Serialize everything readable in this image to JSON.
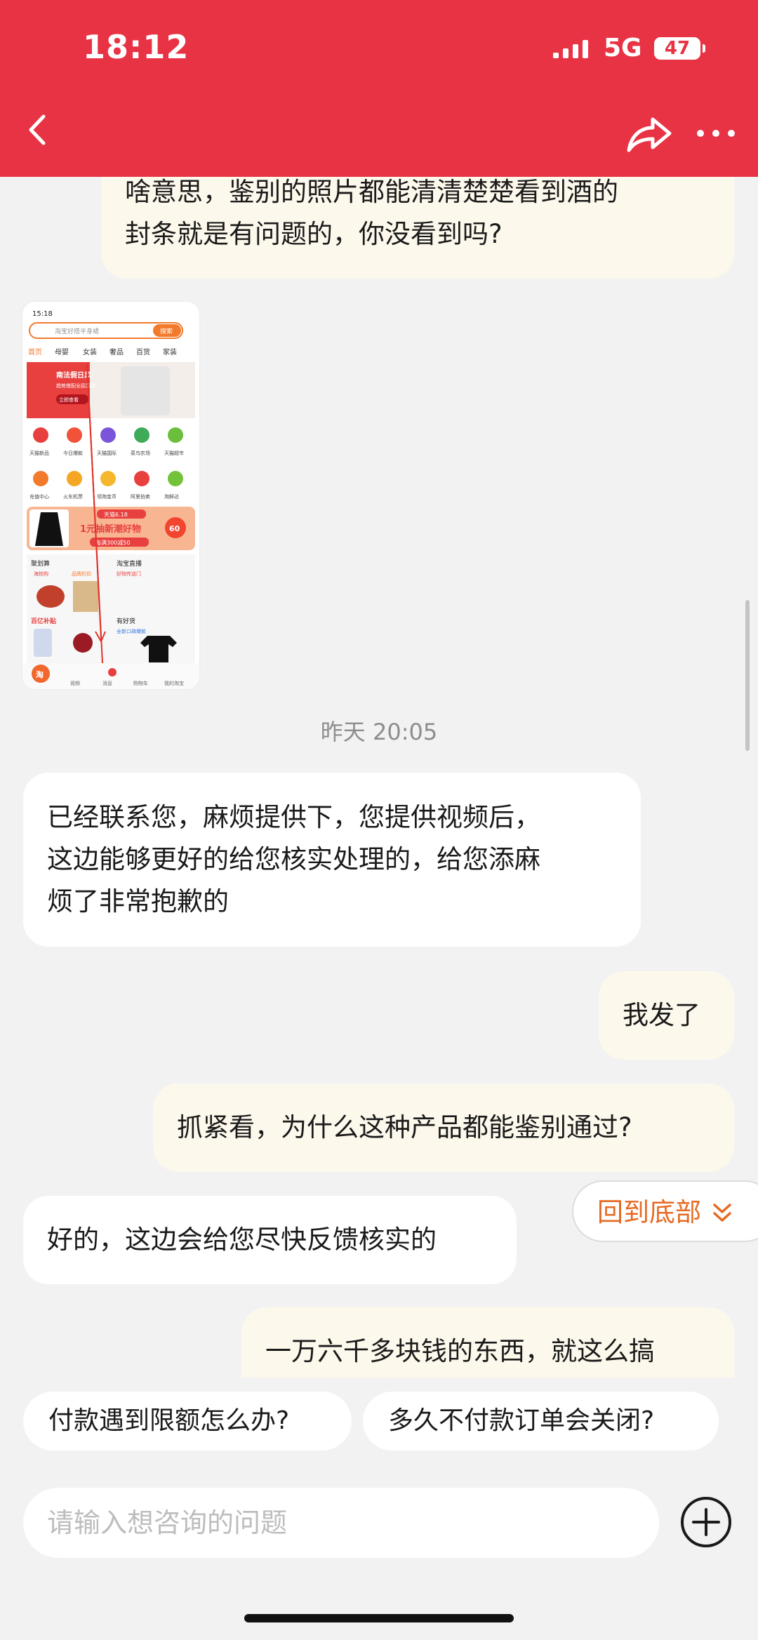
{
  "status_bar": {
    "time": "18:12",
    "network": "5G",
    "battery": "47"
  },
  "messages": {
    "m1": {
      "line1": "啥意思，鉴别的照片都能清清楚楚看到酒的",
      "line2": "封条就是有问题的，你没看到吗?"
    },
    "timestamp": "昨天 20:05",
    "m2": {
      "line1": "已经联系您，麻烦提供下，您提供视频后，",
      "line2": "这边能够更好的给您核实处理的，给您添麻",
      "line3": "烦了非常抱歉的"
    },
    "m3": "我发了",
    "m4": "抓紧看，为什么这种产品都能鉴别通过?",
    "m5": "好的，这边会给您尽快反馈核实的",
    "m6": "一万六千多块钱的东西，就这么搞"
  },
  "thumbnail": {
    "time": "15:18",
    "search_placeholder": "淘宝好搭半身裙",
    "search_button": "搜索",
    "tabs": [
      "首页",
      "母婴",
      "女装",
      "奢品",
      "百货",
      "家装"
    ],
    "banner_title": "南法假日风",
    "banner_sub": "趋势搭配全民围观",
    "banner_btn": "立即查看",
    "icons_row1": [
      "天猫新品",
      "今日爆款",
      "天猫国际",
      "菜鸟农场",
      "天猫超市"
    ],
    "icons_row2": [
      "充值中心",
      "火车机票",
      "领淘金币",
      "阿里拍卖",
      "淘鲜达"
    ],
    "promo_tag": "天猫6.18",
    "promo_text": "1元抽新潮好物",
    "promo_sub": "每满300减50",
    "promo_badge": "60",
    "sec1": "聚划算",
    "sec1_tag1": "海抢购",
    "sec1_tag2": "品牌折扣",
    "sec2": "淘宝直播",
    "sec2_sub": "好物传送门",
    "sec3": "百亿补贴",
    "sec4": "有好货",
    "sec4_sub": "全新口碑爆款",
    "nav": [
      "淘",
      "视频",
      "消息",
      "购物车",
      "我的淘宝"
    ]
  },
  "jump_to_bottom": "回到底部",
  "quick_replies": [
    "付款遇到限额怎么办?",
    "多久不付款订单会关闭?"
  ],
  "input": {
    "placeholder": "请输入想咨询的问题"
  },
  "colors": {
    "header": "#e83344",
    "accent": "#e66a22",
    "my_bubble": "#fdf8ec"
  }
}
